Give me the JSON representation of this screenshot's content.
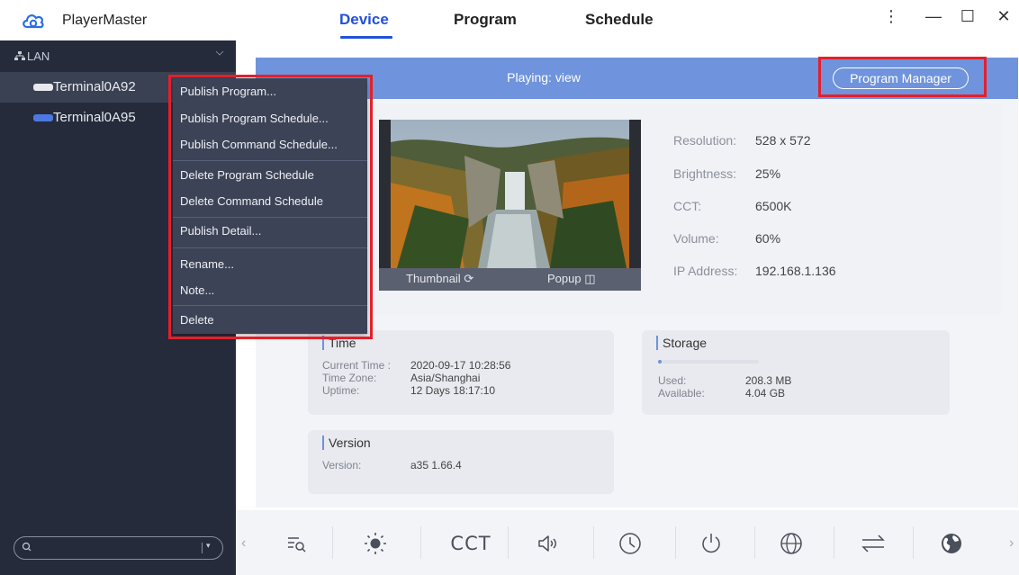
{
  "app": {
    "name": "PlayerMaster"
  },
  "tabs": [
    {
      "label": "Device",
      "active": true
    },
    {
      "label": "Program",
      "active": false
    },
    {
      "label": "Schedule",
      "active": false
    }
  ],
  "window_controls": {
    "more": "⋮",
    "minimize": "—",
    "maximize": "☐",
    "close": "✕"
  },
  "sidebar": {
    "group_label": "LAN",
    "terminals": [
      {
        "label": "Terminal0A92",
        "selected": true
      },
      {
        "label": "Terminal0A95",
        "selected": false
      }
    ],
    "search": {
      "placeholder": "",
      "value": ""
    }
  },
  "context_menu": {
    "items": [
      "Publish Program...",
      "Publish Program Schedule...",
      "Publish Command Schedule...",
      "Delete Program Schedule",
      "Delete Command Schedule",
      "Publish Detail...",
      "Rename...",
      "Note...",
      "Delete"
    ]
  },
  "player": {
    "playing_text": "Playing: view",
    "program_manager_label": "Program Manager",
    "thumbnail_label": "Thumbnail",
    "popup_label": "Popup"
  },
  "specs": [
    {
      "label": "Resolution:",
      "value": "528 x 572"
    },
    {
      "label": "Brightness:",
      "value": "25%"
    },
    {
      "label": "CCT:",
      "value": "6500K"
    },
    {
      "label": "Volume:",
      "value": "60%"
    },
    {
      "label": "IP Address:",
      "value": "192.168.1.136"
    }
  ],
  "time_card": {
    "title": "Time",
    "rows": [
      {
        "label": "Current Time :",
        "value": "2020-09-17 10:28:56"
      },
      {
        "label": "Time Zone:",
        "value": "Asia/Shanghai"
      },
      {
        "label": "Uptime:",
        "value": "12 Days 18:17:10"
      }
    ]
  },
  "storage_card": {
    "title": "Storage",
    "used_fraction": 0.04,
    "rows": [
      {
        "label": "Used:",
        "value": "208.3 MB"
      },
      {
        "label": "Available:",
        "value": "4.04 GB"
      }
    ]
  },
  "version_card": {
    "title": "Version",
    "label": "Version:",
    "value": "a35 1.66.4"
  },
  "toolbar": {
    "cct_label": "CCT",
    "icons": [
      "list-search-icon",
      "brightness-icon",
      "cct-icon",
      "volume-icon",
      "clock-icon",
      "power-icon",
      "network-icon",
      "transfer-icon",
      "globe-icon"
    ]
  },
  "colors": {
    "accent": "#2251d9",
    "sidebar": "#252b3b",
    "menu": "#3c4356",
    "highlight": "#e3202b",
    "bar": "#6f93dc"
  }
}
